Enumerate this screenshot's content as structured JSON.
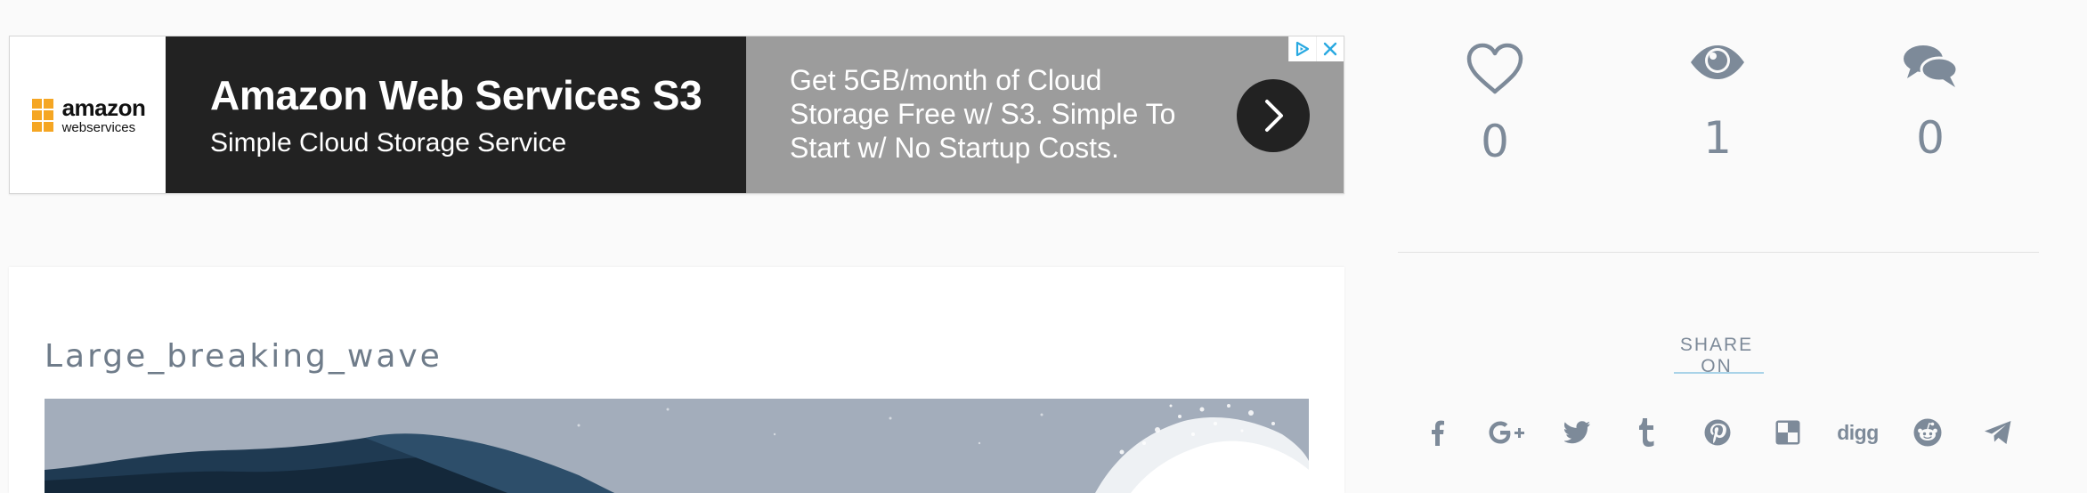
{
  "ad": {
    "logo_word": "amazon",
    "logo_sub": "webservices",
    "title": "Amazon Web Services S3",
    "subtitle": "Simple Cloud Storage Service",
    "description": "Get 5GB/month of Cloud Storage Free w/ S3. Simple To Start w/ No Startup Costs.",
    "arrow_icon": "chevron-right-icon",
    "choices_icon": "adchoices-icon",
    "close_icon": "close-icon",
    "colors": {
      "dark": "#222222",
      "gray": "#9c9c9c",
      "aws_orange": "#f5a623",
      "adchoices_blue": "#29a9e1"
    }
  },
  "stats": {
    "likes": {
      "icon": "heart-icon",
      "value": "0"
    },
    "views": {
      "icon": "eye-icon",
      "value": "1"
    },
    "comments": {
      "icon": "comments-icon",
      "value": "0"
    }
  },
  "share": {
    "label": "SHARE ON",
    "digg_label": "digg",
    "icons": [
      "facebook-icon",
      "google-plus-icon",
      "twitter-icon",
      "tumblr-icon",
      "pinterest-icon",
      "delicious-icon",
      "digg-icon",
      "reddit-icon",
      "telegram-icon"
    ]
  },
  "post": {
    "title": "Large_breaking_wave",
    "image_subject": "wave"
  },
  "colors": {
    "muted_text": "#7d8a99",
    "accent_underline": "#a9d3e8",
    "background": "#fafafa"
  }
}
